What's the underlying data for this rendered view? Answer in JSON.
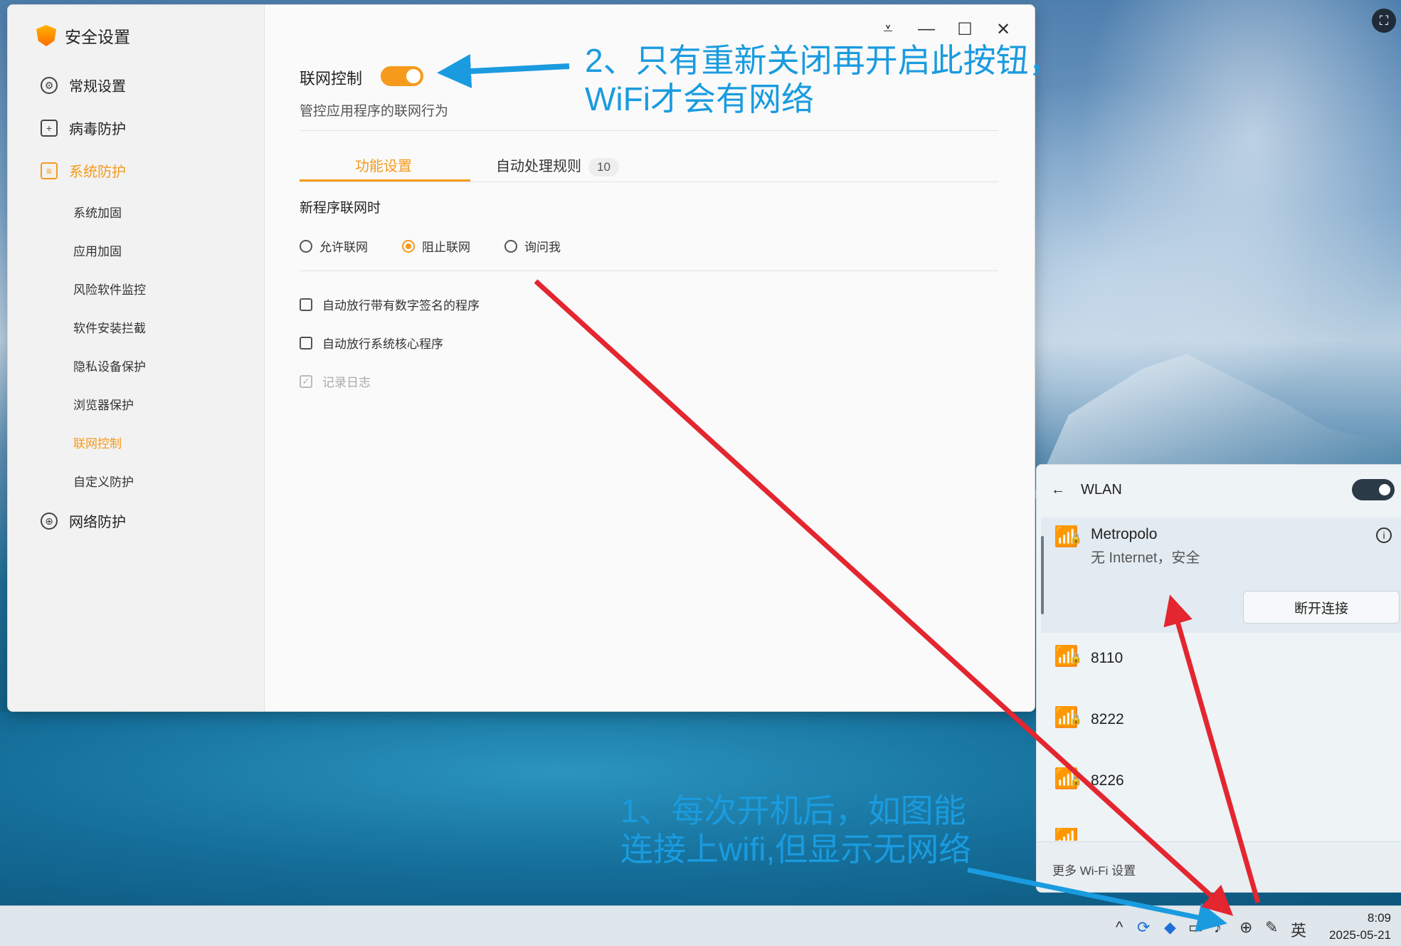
{
  "app": {
    "title": "安全设置",
    "nav": {
      "general": "常规设置",
      "virus": "病毒防护",
      "system": "系统防护",
      "network_protect": "网络防护",
      "sub_items": [
        "系统加固",
        "应用加固",
        "风险软件监控",
        "软件安装拦截",
        "隐私设备保护",
        "浏览器保护",
        "联网控制",
        "自定义防护"
      ]
    },
    "window_controls": [
      "menu-icon",
      "minimize-icon",
      "maximize-icon",
      "close-icon"
    ],
    "main": {
      "feature_title": "联网控制",
      "feature_enabled": true,
      "feature_desc": "管控应用程序的联网行为",
      "tabs": [
        {
          "label": "功能设置"
        },
        {
          "label": "自动处理规则",
          "count": "10"
        }
      ],
      "new_program_label": "新程序联网时",
      "radio_options": [
        "允许联网",
        "阻止联网",
        "询问我"
      ],
      "radio_selected": "阻止联网",
      "checkboxes": [
        {
          "label": "自动放行带有数字签名的程序",
          "checked": false
        },
        {
          "label": "自动放行系统核心程序",
          "checked": false
        },
        {
          "label": "记录日志",
          "checked": true,
          "disabled": true
        }
      ]
    }
  },
  "wlan": {
    "title": "WLAN",
    "enabled": true,
    "networks": [
      {
        "name": "Metropolo",
        "status": "无 Internet，安全",
        "connected": true
      },
      {
        "name": "8110"
      },
      {
        "name": "8222"
      },
      {
        "name": "8226"
      }
    ],
    "disconnect_label": "断开连接",
    "more_settings": "更多 Wi-Fi 设置"
  },
  "taskbar": {
    "ime": "英",
    "time": "8:09",
    "date": "2025-05-21"
  },
  "annotations": {
    "note2_line1": "2、只有重新关闭再开启此按钮，",
    "note2_line2": "WiFi才会有网络",
    "note1_line1": "1、每次开机后，如图能",
    "note1_line2": "连接上wifi,但显示无网络"
  },
  "colors": {
    "accent": "#f59a1b",
    "annotation_blue": "#1a9bdf",
    "arrow_red": "#e3262f"
  }
}
